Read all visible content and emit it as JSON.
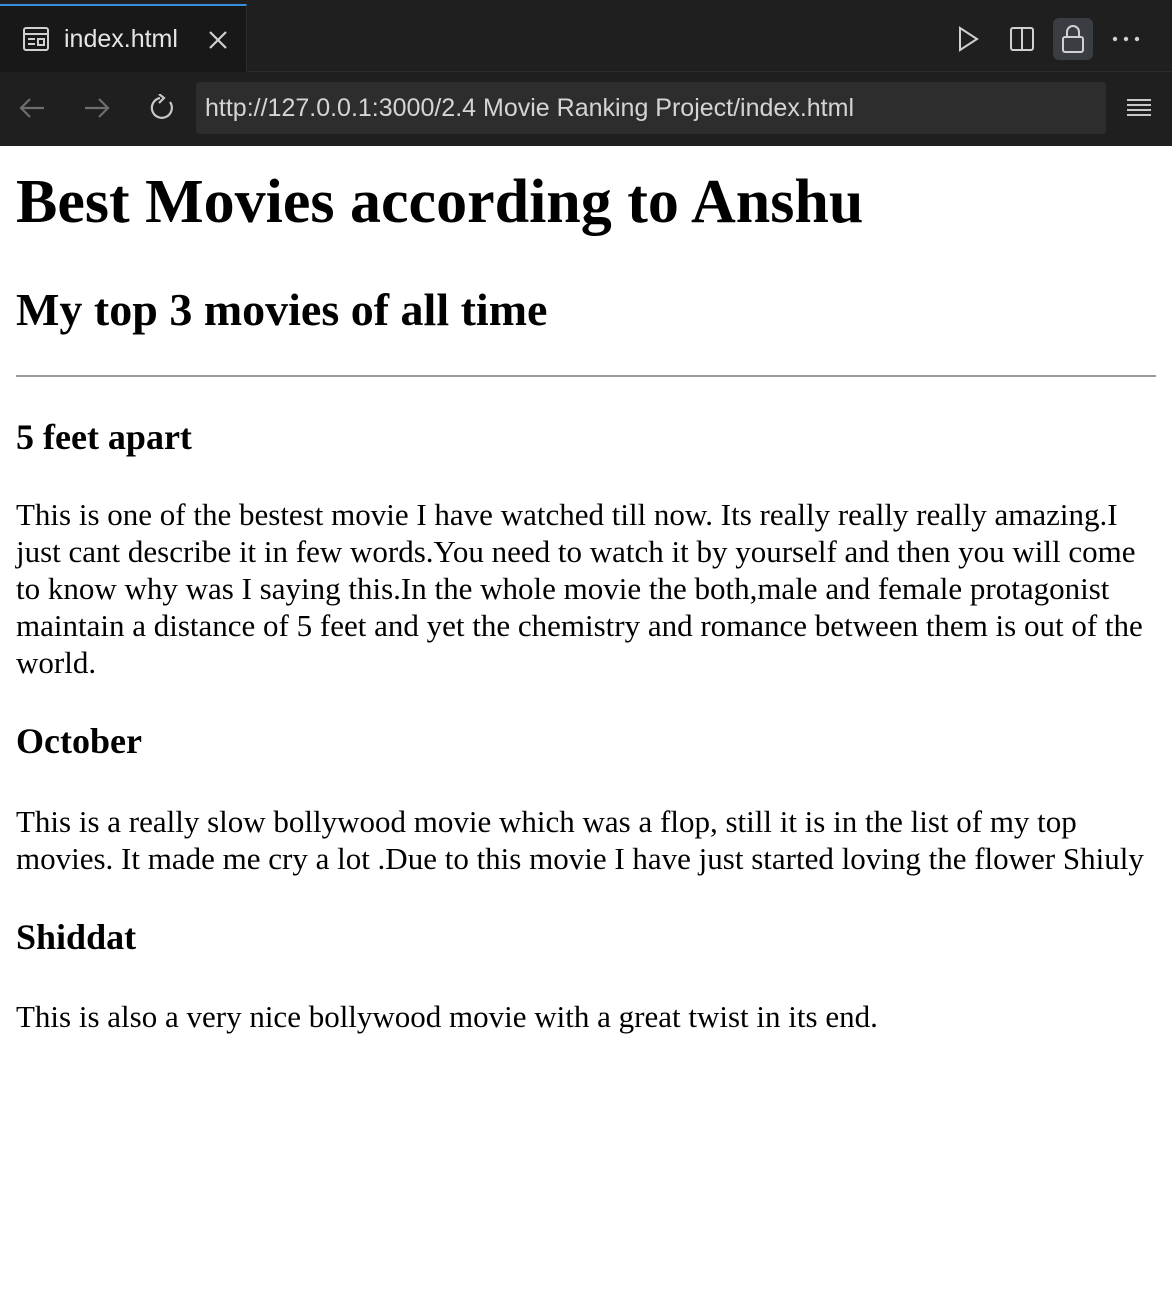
{
  "window": {
    "tab": {
      "label": "index.html",
      "icon": "browser-preview-icon"
    },
    "toolbar_icons": [
      "play-icon",
      "split-editor-icon",
      "lock-icon",
      "more-icon"
    ]
  },
  "nav": {
    "url": "http://127.0.0.1:3000/2.4 Movie Ranking Project/index.html",
    "icons": [
      "back-arrow-icon",
      "forward-arrow-icon",
      "reload-icon",
      "menu-icon"
    ]
  },
  "page": {
    "title": "Best Movies according to Anshu",
    "subtitle": "My top 3 movies of all time",
    "movies": [
      {
        "name": "5 feet apart",
        "description": "This is one of the bestest movie I have watched till now. Its really really really amazing.I just cant describe it in few words.You need to watch it by yourself and then you will come to know why was I saying this.In the whole movie the both,male and female protagonist maintain a distance of 5 feet and yet the chemistry and romance between them is out of the world."
      },
      {
        "name": "October",
        "description": "This is a really slow bollywood movie which was a flop, still it is in the list of my top movies. It made me cry a lot .Due to this movie I have just started loving the flower Shiuly"
      },
      {
        "name": "Shiddat",
        "description": "This is also a very nice bollywood movie with a great twist in its end."
      }
    ]
  },
  "colors": {
    "chrome_bg": "#1f1f1f",
    "tab_active_bg": "#181818",
    "tab_accent": "#3a8be0",
    "url_bg": "#2d2d2d",
    "page_bg": "#ffffff"
  }
}
